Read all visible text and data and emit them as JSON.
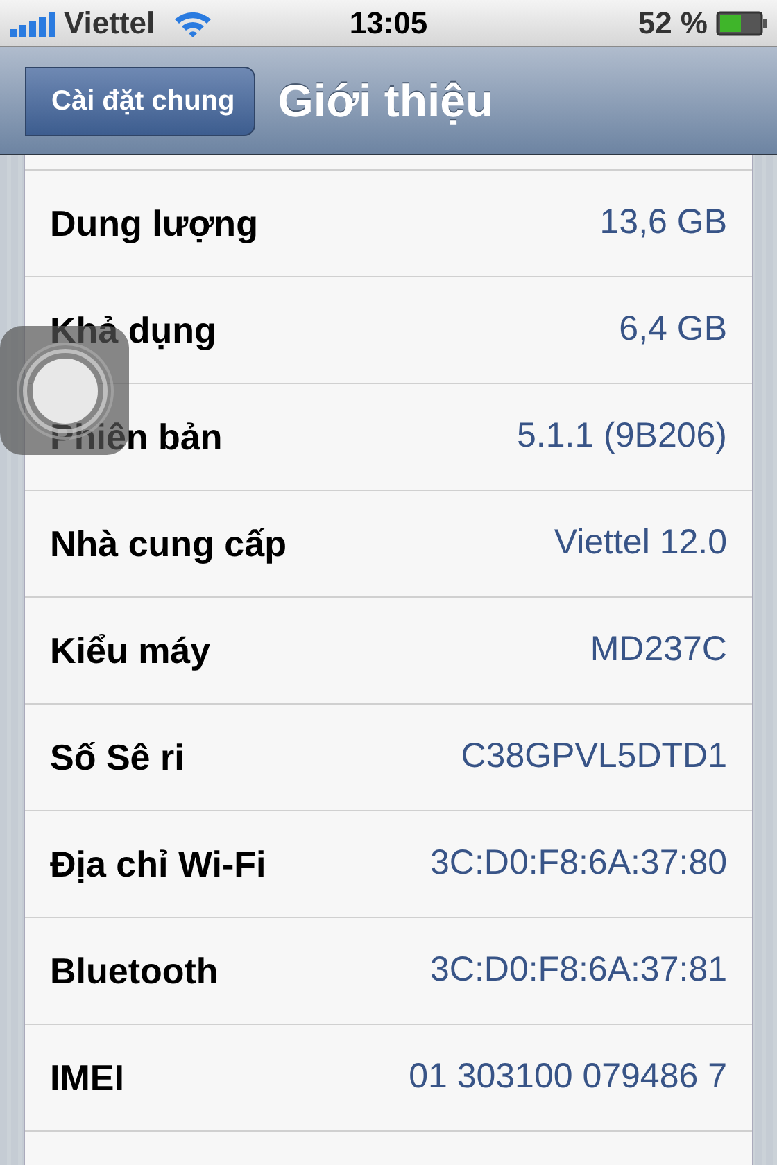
{
  "status_bar": {
    "carrier": "Viettel",
    "time": "13:05",
    "battery": "52 %"
  },
  "nav": {
    "back": "Cài đặt chung",
    "title": "Giới thiệu"
  },
  "rows": [
    {
      "label": "Dung lượng",
      "value": "13,6 GB"
    },
    {
      "label": "Khả dụng",
      "value": "6,4 GB"
    },
    {
      "label": "Phiên bản",
      "value": "5.1.1 (9B206)"
    },
    {
      "label": "Nhà cung cấp",
      "value": "Viettel 12.0"
    },
    {
      "label": "Kiểu máy",
      "value": "MD237C"
    },
    {
      "label": "Số Sê ri",
      "value": "C38GPVL5DTD1"
    },
    {
      "label": "Địa chỉ Wi-Fi",
      "value": "3C:D0:F8:6A:37:80"
    },
    {
      "label": "Bluetooth",
      "value": "3C:D0:F8:6A:37:81"
    },
    {
      "label": "IMEI",
      "value": "01 303100 079486 7"
    }
  ]
}
